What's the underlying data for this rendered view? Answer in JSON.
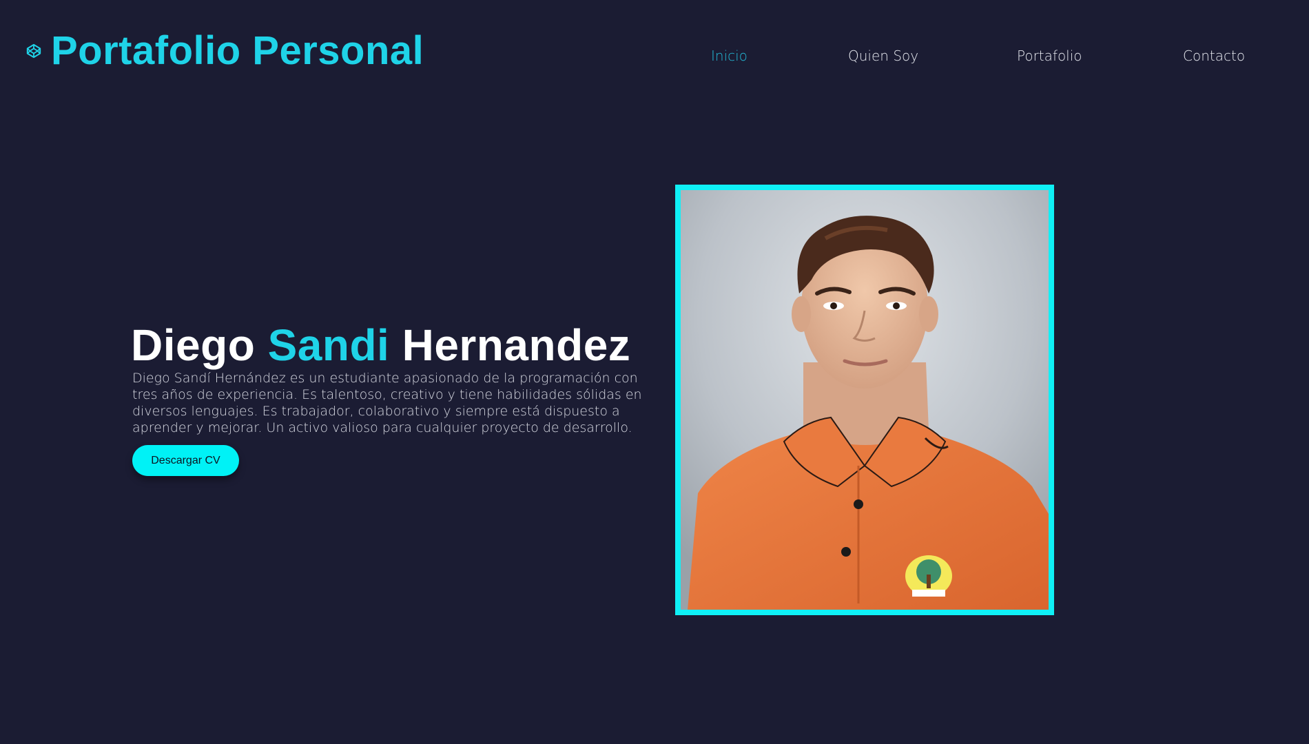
{
  "header": {
    "logo_text": "Portafolio Personal",
    "logo_icon": "codepen-cube-icon"
  },
  "nav": {
    "items": [
      {
        "label": "Inicio",
        "active": true
      },
      {
        "label": "Quien Soy",
        "active": false
      },
      {
        "label": "Portafolio",
        "active": false
      },
      {
        "label": "Contacto",
        "active": false
      }
    ]
  },
  "hero": {
    "name_first": "Diego",
    "name_middle": "Sandi",
    "name_last": "Hernandez",
    "description": "Diego Sandí Hernández es un estudiante apasionado de la programación con tres años de experiencia. Es talentoso, creativo y tiene habilidades sólidas en diversos lenguajes. Es trabajador, colaborativo y siempre está dispuesto a aprender y mejorar. Un activo valioso para cualquier proyecto de desarrollo.",
    "cv_button_label": "Descargar CV",
    "photo_alt": "Foto de perfil"
  },
  "colors": {
    "background": "#1b1c33",
    "accent": "#1fd3e8",
    "active_nav": "#23b9d6",
    "button": "#00f2f6",
    "frame": "#0ff0f6",
    "shirt": "#e5763d"
  }
}
